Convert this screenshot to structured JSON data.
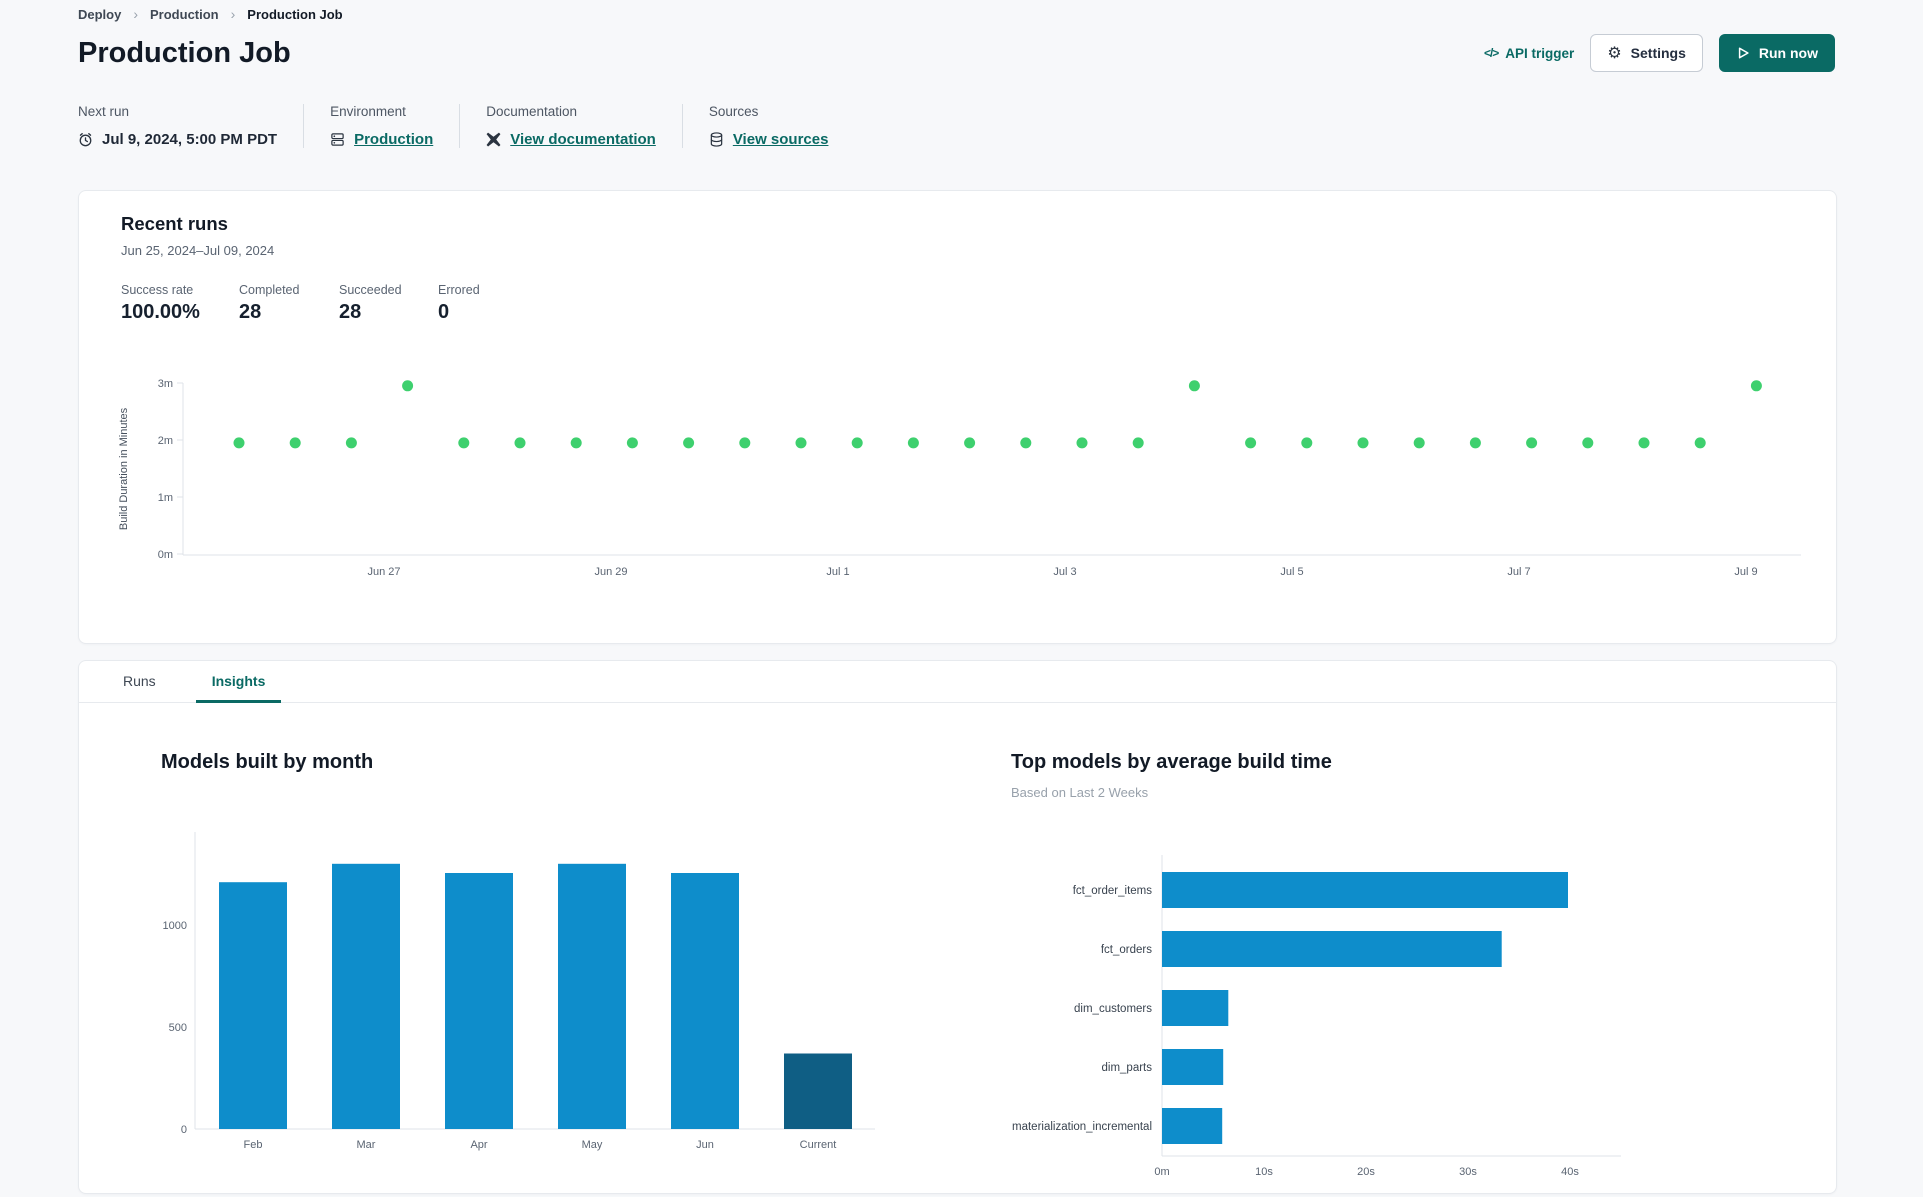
{
  "colors": {
    "accent": "#0a6a64",
    "bar_blue": "#0e8dcb",
    "bar_navy": "#0f5e84",
    "dot_green": "#3ed06e",
    "page_bg": "#f7f8fa",
    "text_dark": "#121a26"
  },
  "breadcrumb": {
    "separator": "›",
    "items": [
      {
        "label": "Deploy"
      },
      {
        "label": "Production"
      },
      {
        "label": "Production Job"
      }
    ]
  },
  "header": {
    "title": "Production Job",
    "api_trigger_glyph": "</>",
    "api_trigger_label": "API trigger",
    "settings_label": "Settings",
    "run_now_label": "Run now"
  },
  "meta": {
    "columns": [
      {
        "label": "Next run",
        "value": "Jul 9, 2024, 5:00 PM PDT",
        "icon": "clock-icon"
      },
      {
        "label": "Environment",
        "value": "Production",
        "icon": "environment-icon"
      },
      {
        "label": "Documentation",
        "value": "View documentation",
        "icon": "dbt-logo-icon"
      },
      {
        "label": "Sources",
        "value": "View sources",
        "icon": "database-icon"
      }
    ]
  },
  "recent_runs": {
    "title": "Recent runs",
    "date_range": "Jun 25, 2024–Jul 09, 2024",
    "stats": [
      {
        "label": "Success rate",
        "value": "100.00%"
      },
      {
        "label": "Completed",
        "value": "28"
      },
      {
        "label": "Succeeded",
        "value": "28"
      },
      {
        "label": "Errored",
        "value": "0"
      }
    ]
  },
  "tabs": [
    {
      "label": "Runs",
      "active": false
    },
    {
      "label": "Insights",
      "active": true
    }
  ],
  "chart_data": [
    {
      "id": "run_durations",
      "type": "scatter",
      "title": "Recent runs",
      "ylabel": "Build Duration in Minutes",
      "y_ticks": [
        "0m",
        "1m",
        "2m",
        "3m"
      ],
      "ylim": [
        0,
        3.2
      ],
      "x_tick_labels": [
        "Jun 27",
        "Jun 29",
        "Jul 1",
        "Jul 3",
        "Jul 5",
        "Jul 7",
        "Jul 9"
      ],
      "grid": false,
      "point_color": "#3ed06e",
      "points_minutes": [
        1.95,
        1.95,
        1.95,
        2.95,
        1.95,
        1.95,
        1.95,
        1.95,
        1.95,
        1.95,
        1.95,
        1.95,
        1.95,
        1.95,
        1.95,
        1.95,
        1.95,
        2.95,
        1.95,
        1.95,
        1.95,
        1.95,
        1.95,
        1.95,
        1.95,
        1.95,
        1.95,
        2.95
      ]
    },
    {
      "id": "models_by_month",
      "type": "bar",
      "title": "Models built by month",
      "categories": [
        "Feb",
        "Mar",
        "Apr",
        "May",
        "Jun",
        "Current"
      ],
      "values": [
        1210,
        1300,
        1255,
        1300,
        1255,
        370
      ],
      "y_ticks": [
        0,
        500,
        1000
      ],
      "ylim": [
        0,
        1360
      ],
      "xlabel": "",
      "ylabel": "",
      "grid": false,
      "bar_color": "#0e8dcb",
      "highlight_color": "#0f5e84",
      "highlight_index": 5
    },
    {
      "id": "top_models_by_build_time",
      "type": "bar-horizontal",
      "title": "Top models by average build time",
      "subtitle": "Based on Last 2 Weeks",
      "categories": [
        "fct_order_items",
        "fct_orders",
        "dim_customers",
        "dim_parts",
        "materialization_incremental"
      ],
      "values_seconds": [
        39.8,
        33.3,
        6.5,
        6.0,
        5.9
      ],
      "x_tick_labels": [
        "0m",
        "10s",
        "20s",
        "30s",
        "40s"
      ],
      "xlim": [
        0,
        44
      ],
      "grid": false,
      "bar_color": "#0e8dcb"
    }
  ]
}
